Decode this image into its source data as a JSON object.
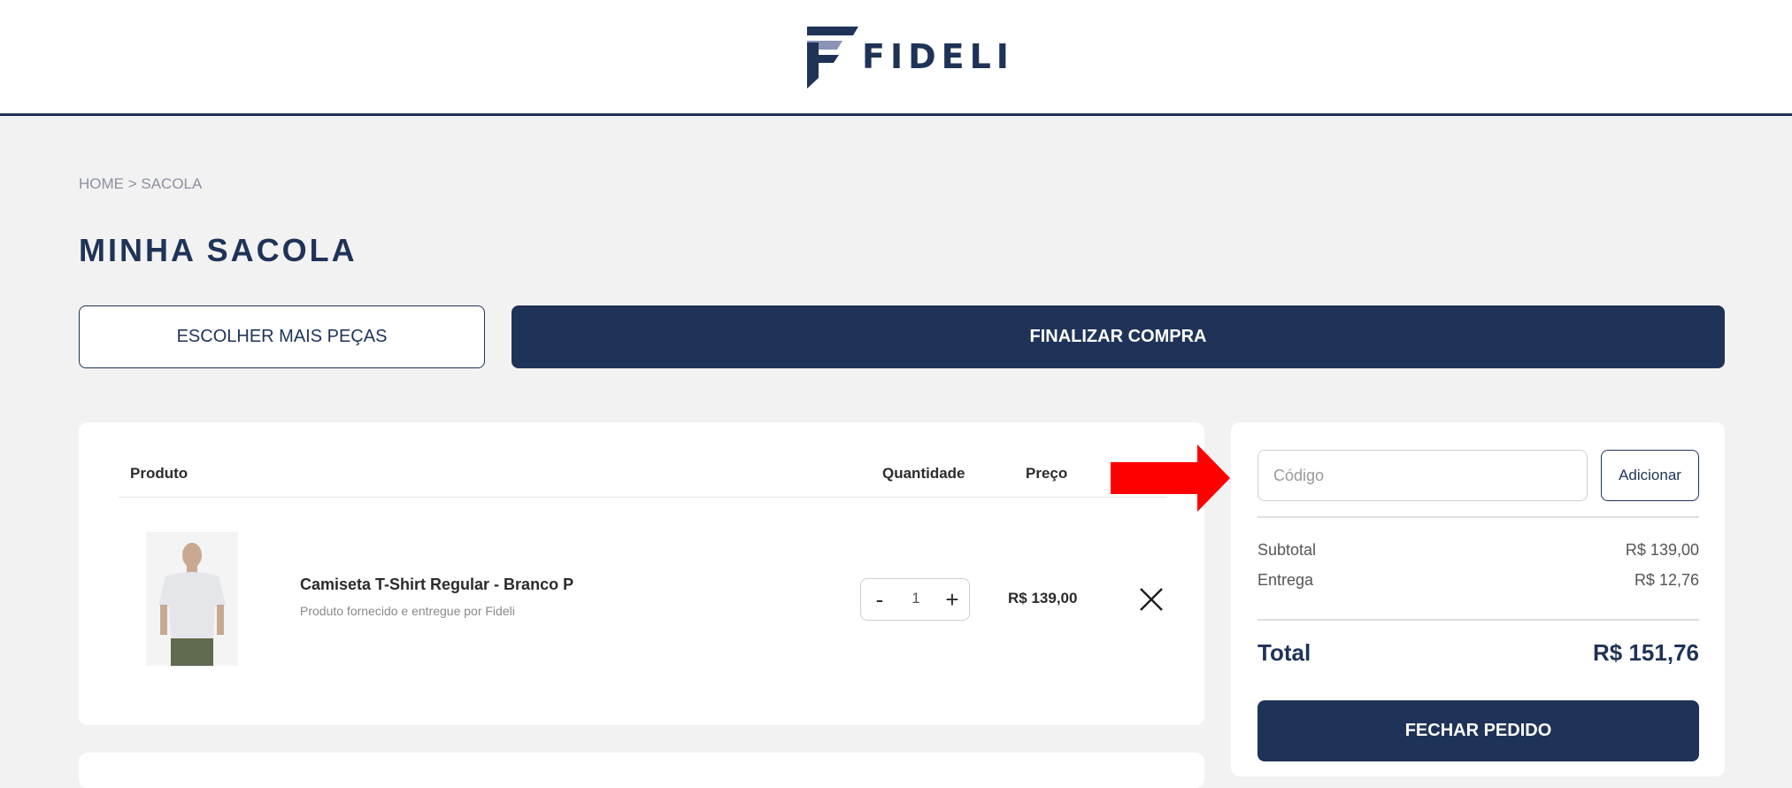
{
  "brand": {
    "logo_text": "FIDELI",
    "primary_color": "#1f3358"
  },
  "breadcrumb": "HOME > SACOLA",
  "page_title": "MINHA SACOLA",
  "actions": {
    "continue_label": "ESCOLHER MAIS PEÇAS",
    "checkout_label": "FINALIZAR COMPRA"
  },
  "cart": {
    "headers": {
      "product": "Produto",
      "quantity": "Quantidade",
      "price": "Preço"
    },
    "items": [
      {
        "name": "Camiseta T-Shirt Regular - Branco P",
        "seller": "Produto fornecido e entregue por Fideli",
        "quantity": "1",
        "minus": "-",
        "plus": "+",
        "price": "R$ 139,00"
      }
    ]
  },
  "annotation": {
    "arrow_color": "#ff0000"
  },
  "summary": {
    "coupon_placeholder": "Código",
    "coupon_button": "Adicionar",
    "subtotal_label": "Subtotal",
    "subtotal_value": "R$ 139,00",
    "shipping_label": "Entrega",
    "shipping_value": "R$ 12,76",
    "total_label": "Total",
    "total_value": "R$ 151,76",
    "checkout_button": "FECHAR PEDIDO"
  }
}
